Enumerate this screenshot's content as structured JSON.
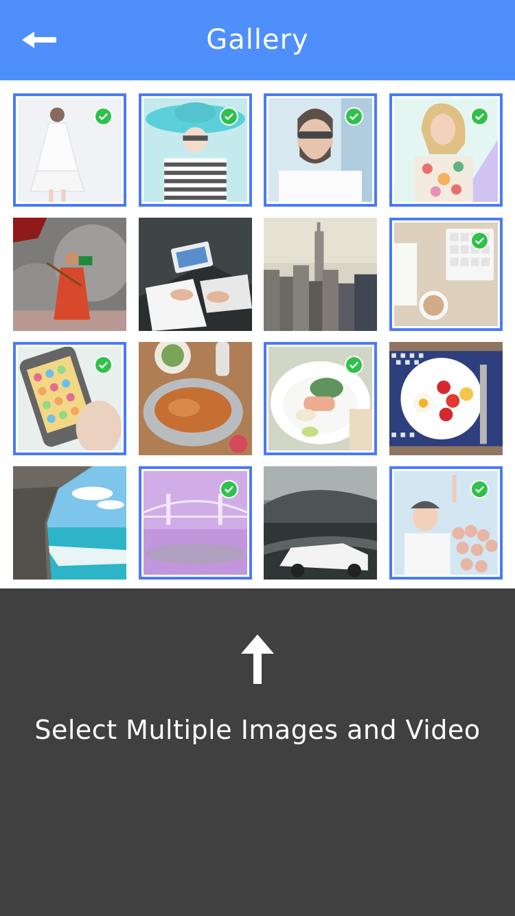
{
  "header": {
    "title": "Gallery",
    "background_color": "#4f8ffb",
    "back_icon": "arrow-left-icon"
  },
  "gallery": {
    "selection_border_color": "#4a7bf5",
    "check_color": "#2fc14b",
    "items": [
      {
        "name": "fashion-woman-white-dress",
        "selected": true
      },
      {
        "name": "woman-sun-hat",
        "selected": true
      },
      {
        "name": "bearded-man-sunglasses",
        "selected": true
      },
      {
        "name": "woman-floral-shirt",
        "selected": true
      },
      {
        "name": "man-with-flag-smoke",
        "selected": false
      },
      {
        "name": "people-working-laptop",
        "selected": false
      },
      {
        "name": "city-skyline",
        "selected": false
      },
      {
        "name": "desk-keyboard-coffee",
        "selected": true
      },
      {
        "name": "phone-candy-game",
        "selected": true
      },
      {
        "name": "roast-chicken-table",
        "selected": false
      },
      {
        "name": "salmon-plate",
        "selected": true
      },
      {
        "name": "breakfast-plate",
        "selected": false
      },
      {
        "name": "beach-cave",
        "selected": false
      },
      {
        "name": "bridge-purple-night",
        "selected": true
      },
      {
        "name": "white-sports-car",
        "selected": false
      },
      {
        "name": "concert-singer-crowd",
        "selected": true
      }
    ]
  },
  "panel": {
    "background_color": "#404040",
    "icon": "arrow-up-icon",
    "caption": "Select Multiple Images and Video"
  }
}
